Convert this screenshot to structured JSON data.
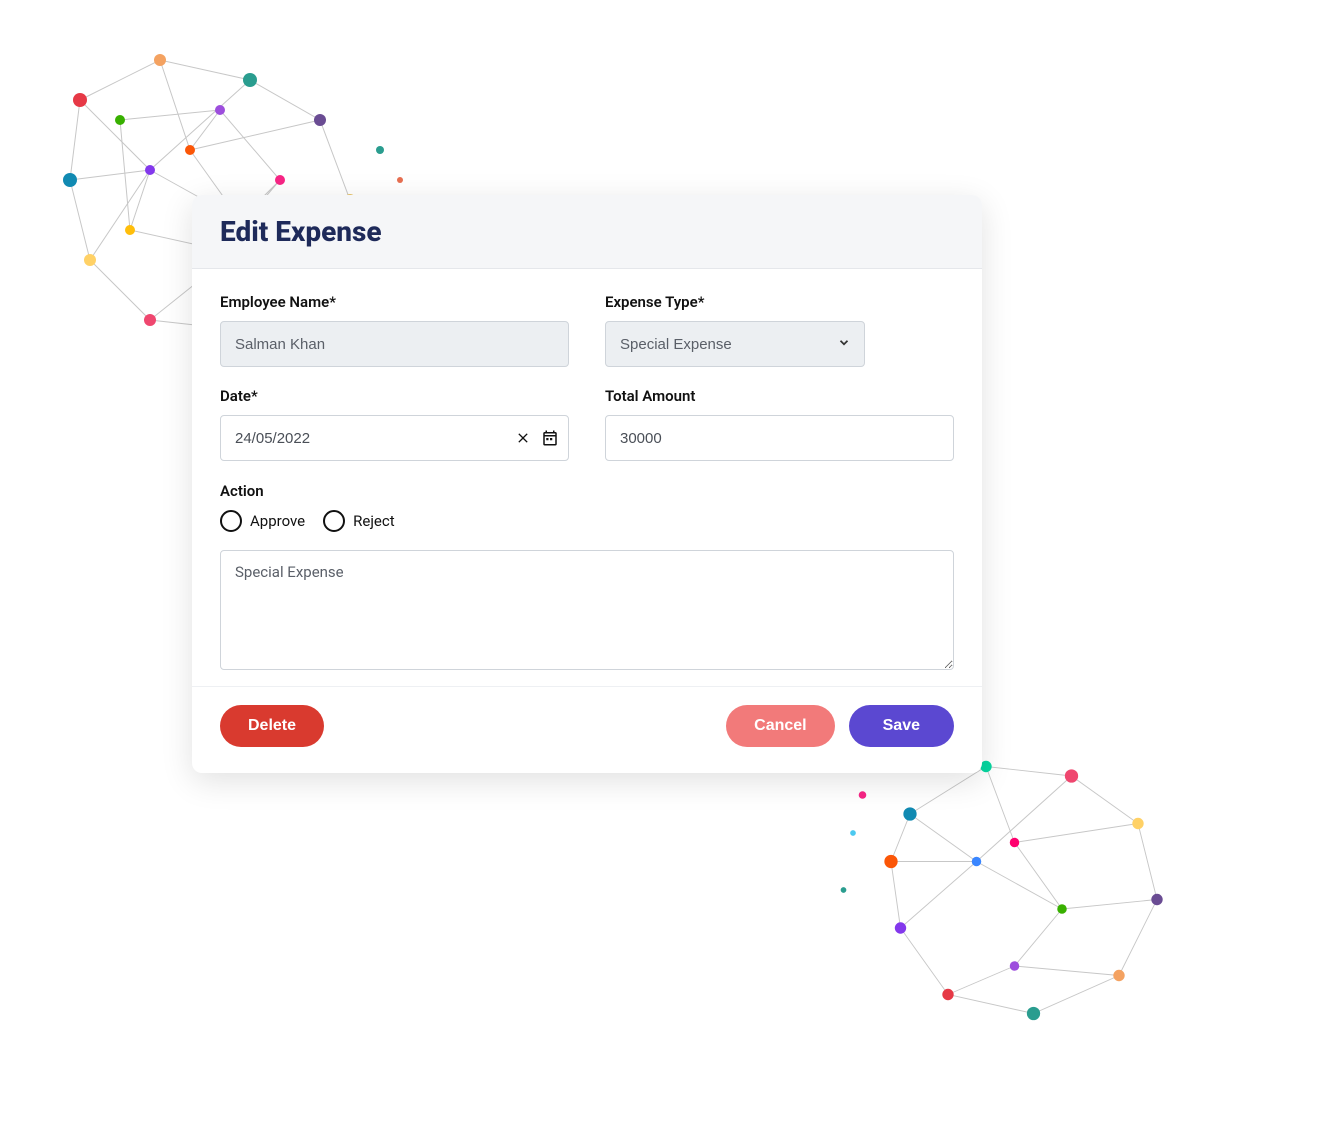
{
  "modal": {
    "title": "Edit Expense",
    "fields": {
      "employee_name": {
        "label": "Employee Name*",
        "value": "Salman Khan"
      },
      "expense_type": {
        "label": "Expense Type*",
        "value": "Special Expense"
      },
      "date": {
        "label": "Date*",
        "value": "24/05/2022"
      },
      "total_amount": {
        "label": "Total Amount",
        "value": "30000"
      },
      "action": {
        "label": "Action",
        "options": {
          "approve": "Approve",
          "reject": "Reject"
        }
      },
      "notes": {
        "value": "Special Expense"
      }
    },
    "buttons": {
      "delete": "Delete",
      "cancel": "Cancel",
      "save": "Save"
    }
  },
  "colors": {
    "title": "#1e2a5a",
    "delete": "#d93a2f",
    "cancel": "#f27a7a",
    "save": "#5b48d1"
  }
}
